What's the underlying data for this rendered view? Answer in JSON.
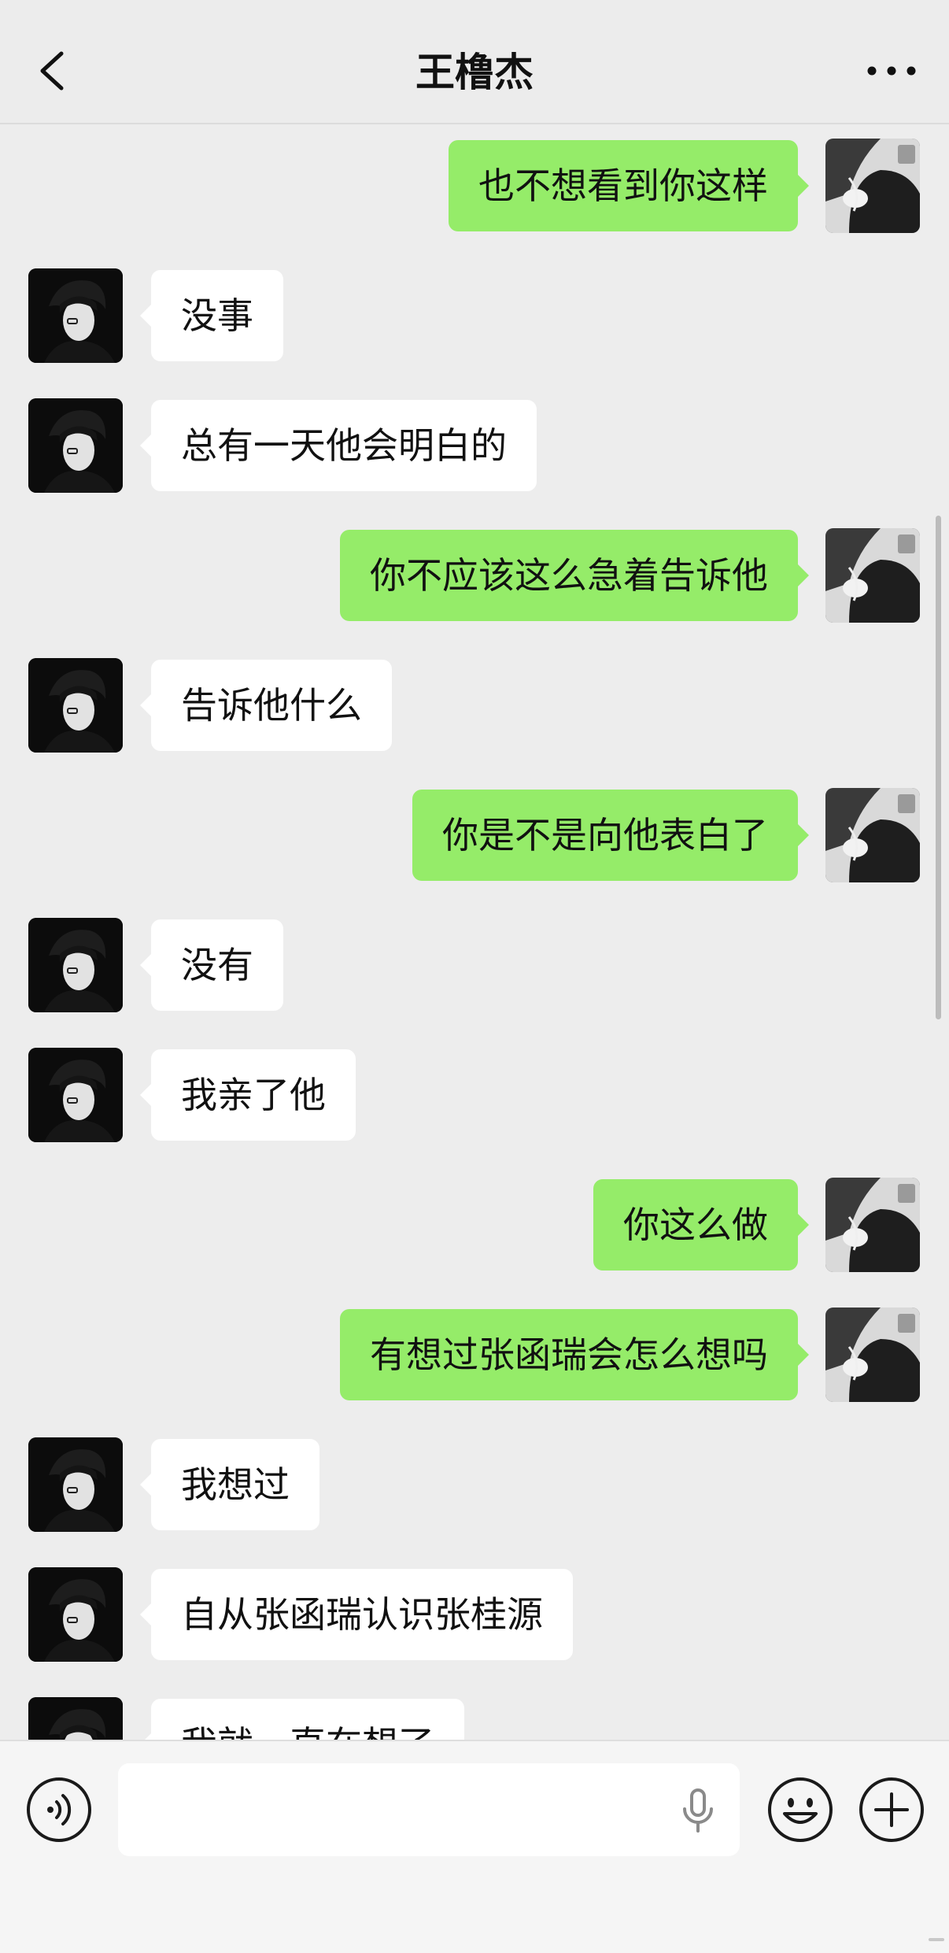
{
  "header": {
    "title": "王橹杰"
  },
  "messages": [
    {
      "side": "me",
      "text": "也不想看到你这样"
    },
    {
      "side": "friend",
      "text": "没事"
    },
    {
      "side": "friend",
      "text": "总有一天他会明白的"
    },
    {
      "side": "me",
      "text": "你不应该这么急着告诉他"
    },
    {
      "side": "friend",
      "text": "告诉他什么"
    },
    {
      "side": "me",
      "text": "你是不是向他表白了"
    },
    {
      "side": "friend",
      "text": "没有"
    },
    {
      "side": "friend",
      "text": "我亲了他"
    },
    {
      "side": "me",
      "text": "你这么做"
    },
    {
      "side": "me",
      "text": "有想过张函瑞会怎么想吗"
    },
    {
      "side": "friend",
      "text": "我想过"
    },
    {
      "side": "friend",
      "text": "自从张函瑞认识张桂源"
    },
    {
      "side": "friend",
      "text": "我就一直在想了"
    }
  ],
  "input": {
    "value": ""
  },
  "icons": {
    "back": "chevron-left-icon",
    "more": "more-dots-icon",
    "voice": "voice-icon",
    "mic": "mic-icon",
    "emoji": "emoji-icon",
    "plus": "plus-icon"
  },
  "colors": {
    "background": "#ededed",
    "my_bubble": "#95ec69",
    "friend_bubble": "#ffffff"
  }
}
